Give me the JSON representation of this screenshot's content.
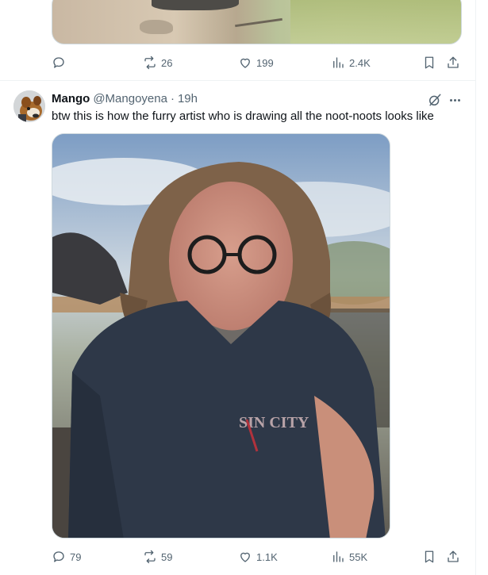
{
  "previous_tweet": {
    "actions": {
      "replies": "",
      "reposts": "26",
      "likes": "199",
      "views": "2.4K"
    }
  },
  "tweet": {
    "author": {
      "name": "Mango",
      "handle": "@Mangoyena",
      "separator": "·",
      "time": "19h"
    },
    "text": "btw this is how the furry artist who is drawing all the noot-noots looks like",
    "photo": {
      "shirt_text": "SIN CITY"
    },
    "actions": {
      "replies": "79",
      "reposts": "59",
      "likes": "1.1K",
      "views": "55K"
    }
  },
  "icons": {
    "reply": "reply-icon",
    "repost": "repost-icon",
    "like": "like-icon",
    "views": "views-icon",
    "bookmark": "bookmark-icon",
    "share": "share-icon",
    "grok": "grok-icon",
    "more": "more-icon"
  },
  "colors": {
    "text_primary": "#0f1419",
    "text_secondary": "#536471",
    "border": "#cfd9de",
    "divider": "#eff3f4"
  }
}
